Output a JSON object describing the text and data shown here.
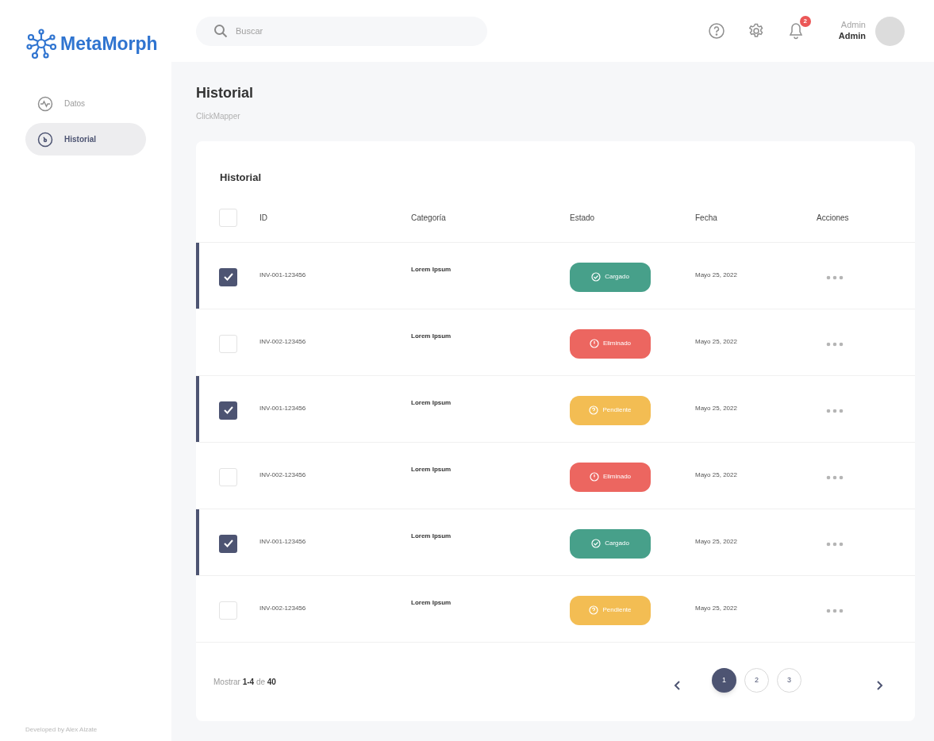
{
  "logo": {
    "text": "MetaMorph"
  },
  "sidebar": {
    "items": [
      {
        "label": "Datos",
        "selected": false
      },
      {
        "label": "Historial",
        "selected": true
      }
    ],
    "footer": "Developed by Alex Alzate"
  },
  "search": {
    "placeholder": "Buscar"
  },
  "header": {
    "notifications": "2",
    "user_role": "Admin",
    "user_name": "Admin"
  },
  "page": {
    "title": "Historial",
    "subtitle": "ClickMapper"
  },
  "table": {
    "title": "Historial",
    "all_checked": false,
    "columns": [
      "ID",
      "Categoría",
      "Estado",
      "Fecha",
      "Acciones"
    ],
    "rows": [
      {
        "checked": true,
        "id": "INV-001-123456",
        "category": "Lorem Ipsum",
        "status": {
          "label": "Cargado",
          "kind": "loaded"
        },
        "date": "Mayo 25, 2022"
      },
      {
        "checked": false,
        "id": "INV-002-123456",
        "category": "Lorem Ipsum",
        "status": {
          "label": "Eliminado",
          "kind": "deleted"
        },
        "date": "Mayo 25, 2022"
      },
      {
        "checked": true,
        "id": "INV-001-123456",
        "category": "Lorem Ipsum",
        "status": {
          "label": "Pendiente",
          "kind": "pending"
        },
        "date": "Mayo 25, 2022"
      },
      {
        "checked": false,
        "id": "INV-002-123456",
        "category": "Lorem Ipsum",
        "status": {
          "label": "Eliminado",
          "kind": "deleted"
        },
        "date": "Mayo 25, 2022"
      },
      {
        "checked": true,
        "id": "INV-001-123456",
        "category": "Lorem Ipsum",
        "status": {
          "label": "Cargado",
          "kind": "loaded"
        },
        "date": "Mayo 25, 2022"
      },
      {
        "checked": false,
        "id": "INV-002-123456",
        "category": "Lorem Ipsum",
        "status": {
          "label": "Pendiente",
          "kind": "pending"
        },
        "date": "Mayo 25, 2022"
      }
    ]
  },
  "pagination": {
    "summary": "Mostrar **1-4** de **40**",
    "pages": [
      {
        "label": "1",
        "selected": true
      },
      {
        "label": "2",
        "selected": false
      },
      {
        "label": "3",
        "selected": false
      }
    ]
  }
}
